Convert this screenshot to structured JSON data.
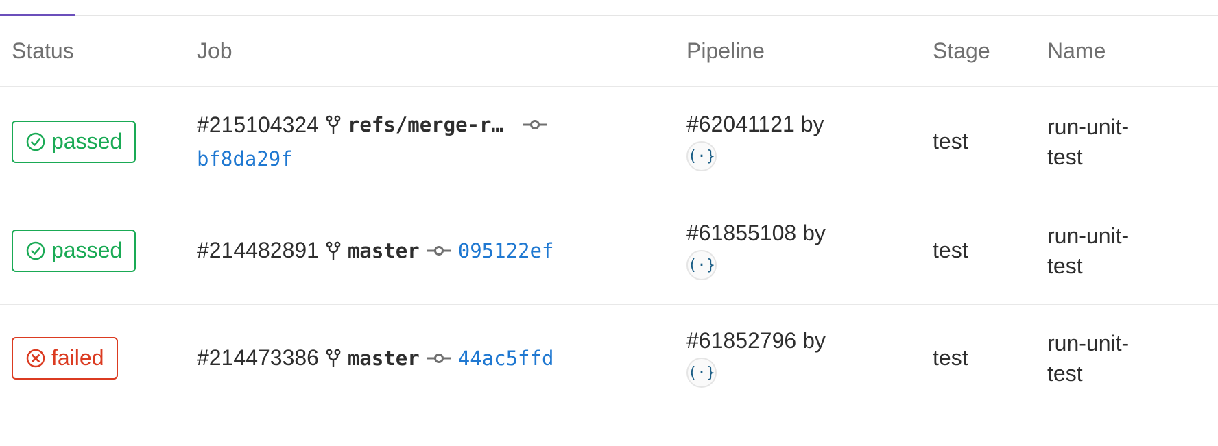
{
  "headers": {
    "status": "Status",
    "job": "Job",
    "pipeline": "Pipeline",
    "stage": "Stage",
    "name": "Name"
  },
  "colors": {
    "passed": "#1aaa55",
    "failed": "#db3b21",
    "link": "#1f78d1",
    "tab_accent": "#6b4fbb"
  },
  "icons": {
    "passed": "check-circle-icon",
    "failed": "x-circle-icon",
    "branch": "branch-icon",
    "commit": "commit-icon",
    "avatar": "avatar-icon"
  },
  "rows": [
    {
      "status": "passed",
      "job_id": "#215104324",
      "ref": "refs/merge-r…",
      "sha": "bf8da29f",
      "pipeline": "#62041121 by",
      "avatar": "(·}",
      "stage": "test",
      "name": "run-unit-test"
    },
    {
      "status": "passed",
      "job_id": "#214482891",
      "ref": "master",
      "sha": "095122ef",
      "pipeline": "#61855108 by",
      "avatar": "(·}",
      "stage": "test",
      "name": "run-unit-test"
    },
    {
      "status": "failed",
      "job_id": "#214473386",
      "ref": "master",
      "sha": "44ac5ffd",
      "pipeline": "#61852796 by",
      "avatar": "(·}",
      "stage": "test",
      "name": "run-unit-test"
    }
  ]
}
